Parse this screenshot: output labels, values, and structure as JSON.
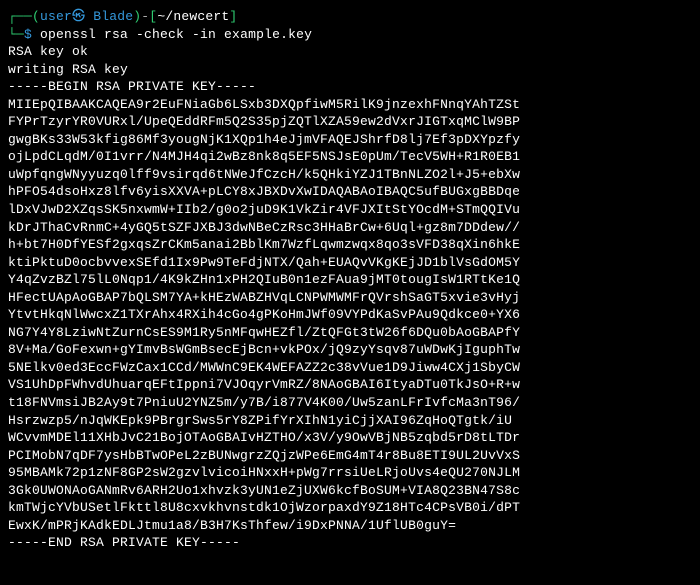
{
  "prompt": {
    "open_paren": "┌──(",
    "user": "user㉿",
    "separator": " ",
    "host": "Blade",
    "close_paren": ")",
    "dash": "-",
    "bracket_open": "[",
    "path": "~/newcert",
    "bracket_close": "]",
    "line2_prefix": "└─",
    "dollar": "$ ",
    "command": "openssl rsa -check -in example.key"
  },
  "output": {
    "line1": "RSA key ok",
    "line2": "writing RSA key",
    "begin_marker": "-----BEGIN RSA PRIVATE KEY-----",
    "key_lines": [
      "MIIEpQIBAAKCAQEA9r2EuFNiaGb6LSxb3DXQpfiwM5RilK9jnzexhFNnqYAhTZSt",
      "FYPrTzyrYR0VURxl/UpeQEddRFm5Q2S35pjZQTlXZA59ew2dVxrJIGTxqMClW9BP",
      "gwgBKs33W53kfig86Mf3yougNjK1XQp1h4eJjmVFAQEJShrfD8lj7Ef3pDXYpzfy",
      "ojLpdCLqdM/0I1vrr/N4MJH4qi2wBz8nk8q5EF5NSJsE0pUm/TecV5WH+R1R0EB1",
      "uWpfqngWNyyuzq0lff9vsirqd6tNWeJfCzcH/k5QHkiYZJ1TBnNLZO2l+J5+ebXw",
      "hPFO54dsoHxz8lfv6yisXXVA+pLCY8xJBXDvXwIDAQABAoIBAQC5ufBUGxgBBDqe",
      "lDxVJwD2XZqsSK5nxwmW+IIb2/g0o2juD9K1VkZir4VFJXItStYOcdM+STmQQIVu",
      "kDrJThaCvRnmC+4yGQ5tSZFJXBJ3dwNBeCzRsc3HHaBrCw+6Uql+gz8m7DDdew//",
      "h+bt7H0DfYESf2gxqsZrCKm5anai2BblKm7WzfLqwmzwqx8qo3sVFD38qXin6hkE",
      "ktiPktuD0ocbvvexSEfd1Ix9Pw9TeFdjNTX/Qah+EUAQvVKgKEjJD1blVsGdOM5Y",
      "Y4qZvzBZl75lL0Nqp1/4K9kZHn1xPH2QIuB0n1ezFAua9jMT0tougIsW1RTtKe1Q",
      "HFectUApAoGBAP7bQLSM7YA+kHEzWABZHVqLCNPWMWMFrQVrshSaGT5xvie3vHyj",
      "YtvtHkqNlWwcxZ1TXrAhx4RXih4cGo4gPKoHmJWf09VYPdKaSvPAu9Qdkce0+YX6",
      "NG7Y4Y8LziwNtZurnCsES9M1Ry5nMFqwHEZfl/ZtQFGt3tW26f6DQu0bAoGBAPfY",
      "8V+Ma/GoFexwn+gYImvBsWGmBsecEjBcn+vkPOx/jQ9zyYsqv87uWDwKjIguphTw",
      "5NElkv0ed3EccFWzCax1CCd/MWWnC9EK4WEFAZZ2c38vVue1D9Jiww4CXj1SbyCW",
      "VS1UhDpFWhvdUhuarqEFtIppni7VJOqyrVmRZ/8NAoGBAI6ItyaDTu0TkJsO+R+w",
      "t18FNVmsiJB2Ay9t7PniuU2YNZ5m/y7B/i877V4K00/Uw5zanLFrIvfcMa3nT96/",
      "Hsrzwzp5/nJqWKEpk9PBrgrSws5rY8ZPifYrXIhN1yiCjjXAI96ZqHoQTgtk/iU",
      "WCvvmMDEl11XHbJvC21BojOTAoGBAIvHZTHO/x3V/y9OwVBjNB5zqbd5rD8tLTDr",
      "PCIMobN7qDF7ysHbBTwOPeL2zBUNwgrzZQjzWPe6EmG4mT4r8Bu8ETI9UL2UvVxS",
      "95MBAMk72p1zNF8GP2sW2gzvlvicoiHNxxH+pWg7rrsiUeLRjoUvs4eQU270NJLM",
      "3Gk0UWONAoGANmRv6ARH2Uo1xhvzk3yUN1eZjUXW6kcfBoSUM+VIA8Q23BN47S8c",
      "kmTWjcYVbUSetlFkttl8U8cxvkhvnstdk1OjWzorpaxdY9Z18HTc4CPsVB0i/dPT",
      "EwxK/mPRjKAdkEDLJtmu1a8/B3H7KsThfew/i9DxPNNA/1UflUB0guY="
    ],
    "end_marker": "-----END RSA PRIVATE KEY-----"
  }
}
